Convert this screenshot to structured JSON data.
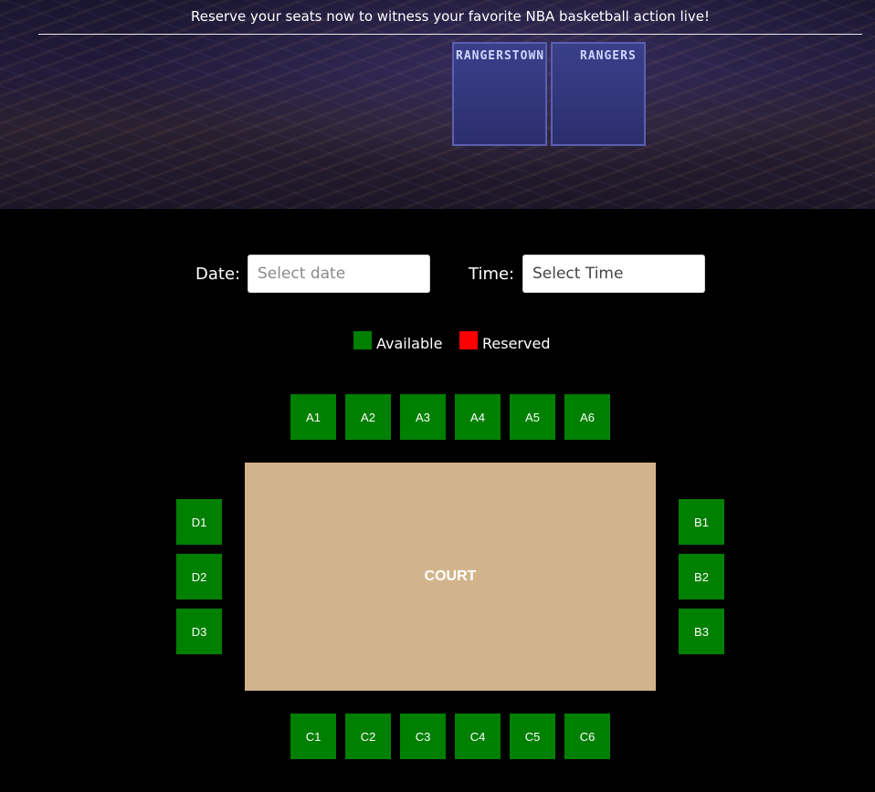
{
  "hero": {
    "tagline": "Reserve your seats now to witness your favorite NBA basketball action live!",
    "scoreboard_text_left": "RANGERSTOWN",
    "scoreboard_text_right": "RANGERS"
  },
  "pickers": {
    "date_label": "Date:",
    "date_placeholder": "Select date",
    "date_value": "",
    "time_label": "Time:",
    "time_placeholder": "Select Time",
    "time_value": ""
  },
  "legend": {
    "available_label": "Available",
    "available_color": "#008000",
    "reserved_label": "Reserved",
    "reserved_color": "#ff0000"
  },
  "court_label": "COURT",
  "seats": {
    "top": [
      "A1",
      "A2",
      "A3",
      "A4",
      "A5",
      "A6"
    ],
    "right": [
      "B1",
      "B2",
      "B3"
    ],
    "bottom": [
      "C1",
      "C2",
      "C3",
      "C4",
      "C5",
      "C6"
    ],
    "left": [
      "D1",
      "D2",
      "D3"
    ],
    "status": "available"
  }
}
